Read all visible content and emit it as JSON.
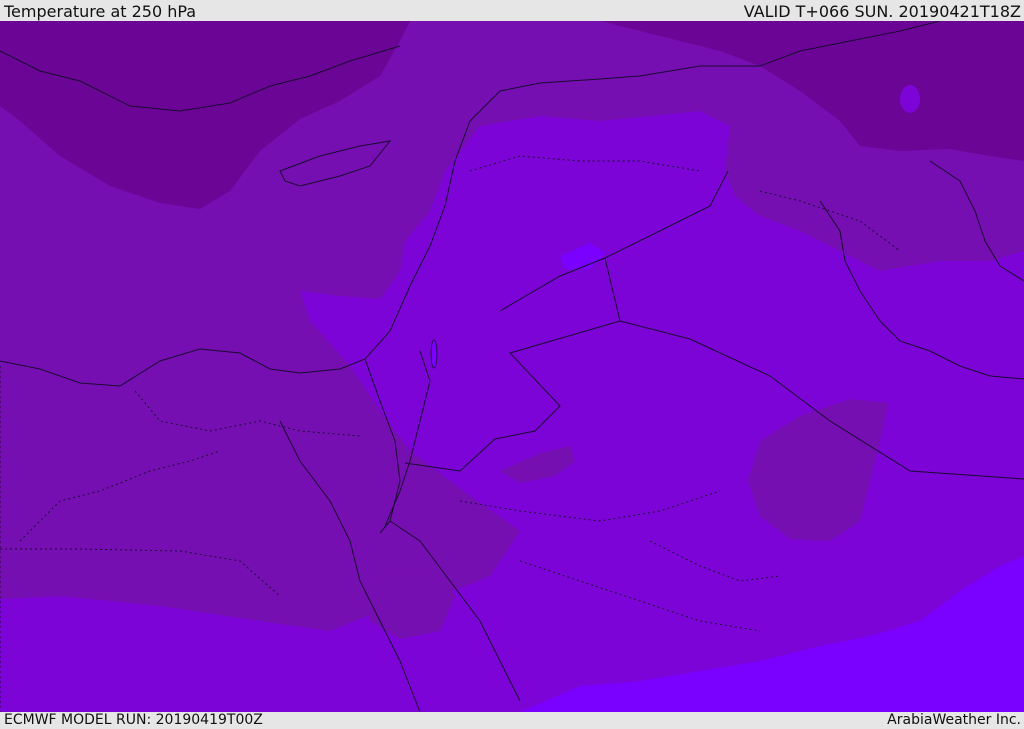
{
  "header": {
    "title": "Temperature at 250 hPa",
    "valid_time": "VALID T+066 SUN. 20190421T18Z"
  },
  "footer": {
    "model_run": "ECMWF MODEL RUN: 20190419T00Z",
    "credit": "ArabiaWeather Inc."
  },
  "map": {
    "region": "Eastern Mediterranean and Middle East",
    "colors": {
      "coldest": "#6a0595",
      "cold": "#760fb1",
      "cool": "#7d04d6",
      "cooler": "#7000d8",
      "mild": "#7a00ff",
      "borders": "#1a0a33"
    }
  }
}
